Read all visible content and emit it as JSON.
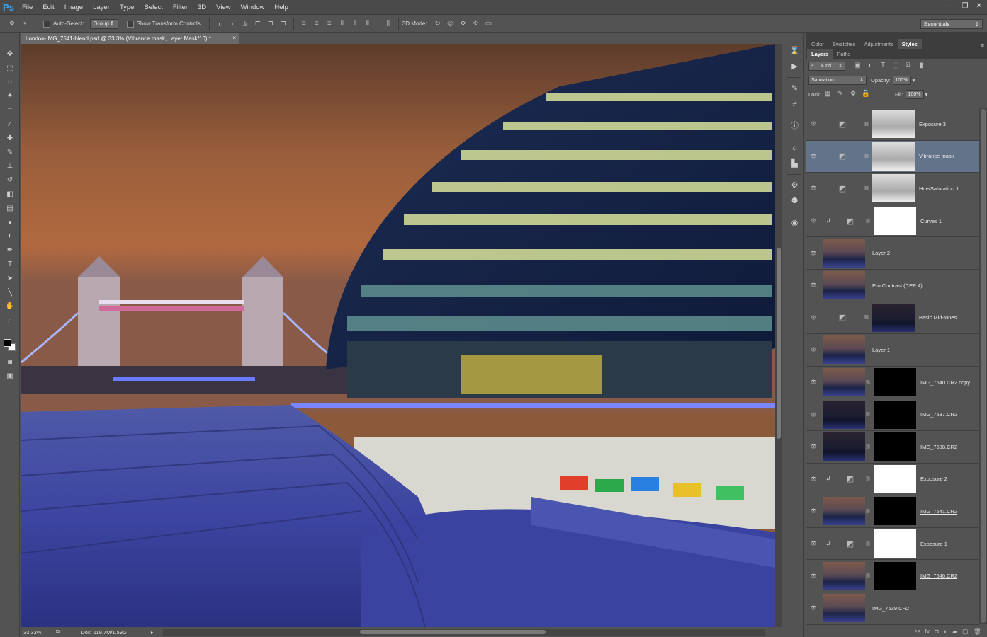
{
  "app": {
    "logo": "Ps"
  },
  "menu": [
    "File",
    "Edit",
    "Image",
    "Layer",
    "Type",
    "Select",
    "Filter",
    "3D",
    "View",
    "Window",
    "Help"
  ],
  "window_controls": [
    "–",
    "❐",
    "✕"
  ],
  "options": {
    "auto_select_label": "Auto-Select:",
    "auto_select_value": "Group",
    "transform_label": "Show Transform Controls",
    "mode_3d_label": "3D Mode:",
    "workspace": "Essentials"
  },
  "document": {
    "tab_title": "London-IMG_7541-blend.psd @ 33.3% (Vibrance mask, Layer Mask/16) *",
    "close": "×",
    "zoom": "33.33%",
    "doc_size": "Doc: 119.7M/1.59G"
  },
  "panel_tabs": [
    {
      "label": "Color",
      "active": false
    },
    {
      "label": "Swatches",
      "active": false
    },
    {
      "label": "Adjustments",
      "active": false
    },
    {
      "label": "Styles",
      "active": true
    }
  ],
  "layer_tabs": [
    {
      "label": "Layers",
      "active": true
    },
    {
      "label": "Paths",
      "active": false
    }
  ],
  "layers_panel": {
    "filter_kind": "Kind",
    "blend_mode": "Saturation",
    "opacity_label": "Opacity:",
    "opacity": "100%",
    "lock_label": "Lock:",
    "fill_label": "Fill:",
    "fill": "100%"
  },
  "layers": [
    {
      "name": "Exposure 3",
      "kind": "adjustment",
      "mask": "gray",
      "selected": false,
      "clipped": false,
      "underline": false
    },
    {
      "name": "Vibrance mask",
      "kind": "adjustment",
      "mask": "gray",
      "selected": true,
      "clipped": false,
      "underline": false
    },
    {
      "name": "Hue/Saturation 1",
      "kind": "adjustment",
      "mask": "gray",
      "selected": false,
      "clipped": false,
      "underline": false
    },
    {
      "name": "Curves 1",
      "kind": "adjustment",
      "mask": "white",
      "selected": false,
      "clipped": true,
      "underline": false
    },
    {
      "name": "Layer 2",
      "kind": "pixel",
      "mask": "",
      "selected": false,
      "clipped": false,
      "underline": true
    },
    {
      "name": "Pro Contrast (CEP 4)",
      "kind": "pixel",
      "mask": "",
      "selected": false,
      "clipped": false,
      "underline": false
    },
    {
      "name": "Basic Mid-tones",
      "kind": "adjustment",
      "mask": "dark",
      "selected": false,
      "clipped": false,
      "underline": false
    },
    {
      "name": "Layer 1",
      "kind": "pixel",
      "mask": "",
      "selected": false,
      "clipped": false,
      "underline": false
    },
    {
      "name": "IMG_7540.CR2 copy",
      "kind": "pixel",
      "mask": "black",
      "selected": false,
      "clipped": false,
      "underline": false
    },
    {
      "name": "IMG_7537.CR2",
      "kind": "pixel-dark",
      "mask": "black",
      "selected": false,
      "clipped": false,
      "underline": false
    },
    {
      "name": "IMG_7538.CR2",
      "kind": "pixel-dark",
      "mask": "black",
      "selected": false,
      "clipped": false,
      "underline": false
    },
    {
      "name": "Exposure 2",
      "kind": "adjustment",
      "mask": "white",
      "selected": false,
      "clipped": true,
      "underline": false
    },
    {
      "name": "IMG_7541.CR2",
      "kind": "pixel",
      "mask": "black",
      "selected": false,
      "clipped": false,
      "underline": true
    },
    {
      "name": "Exposure 1",
      "kind": "adjustment",
      "mask": "white",
      "selected": false,
      "clipped": true,
      "underline": false
    },
    {
      "name": "IMG_7540.CR2",
      "kind": "pixel",
      "mask": "black",
      "selected": false,
      "clipped": false,
      "underline": true
    },
    {
      "name": "IMG_7539.CR2",
      "kind": "pixel",
      "mask": "",
      "selected": false,
      "clipped": false,
      "underline": false
    }
  ],
  "tools": [
    "move-tool",
    "marquee-tool",
    "lasso-tool",
    "quick-select-tool",
    "crop-tool",
    "eyedropper-tool",
    "healing-tool",
    "brush-tool",
    "clone-stamp-tool",
    "history-brush-tool",
    "eraser-tool",
    "gradient-tool",
    "blur-tool",
    "dodge-tool",
    "pen-tool",
    "type-tool",
    "path-select-tool",
    "line-tool",
    "hand-tool",
    "zoom-tool"
  ],
  "colors": {
    "accent_blue": "#31a8ff",
    "selected_layer": "#63738a",
    "panel_bg": "#535353"
  }
}
